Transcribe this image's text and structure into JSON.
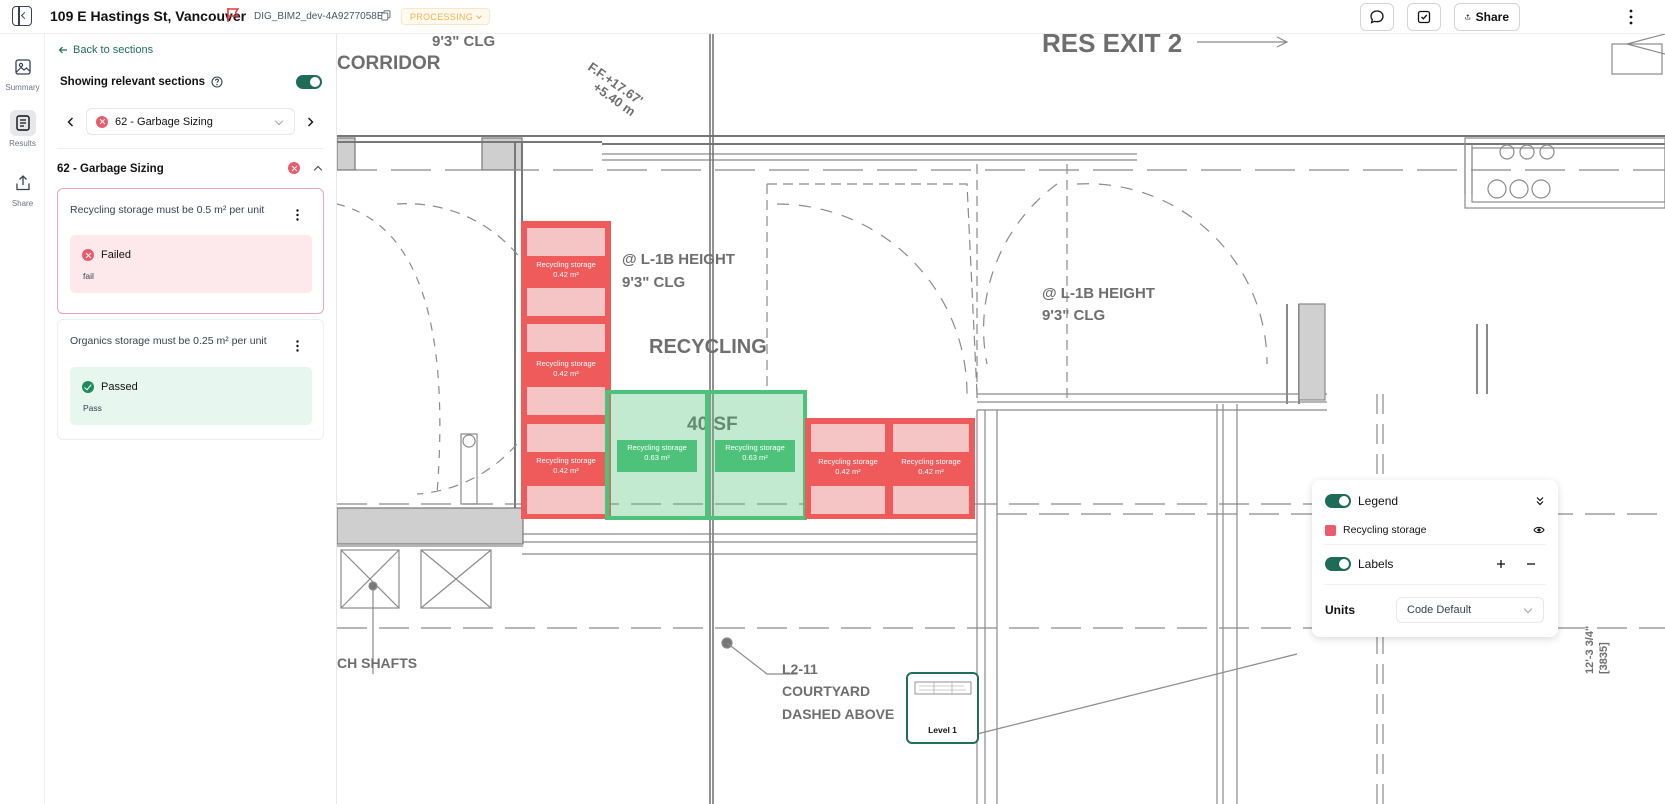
{
  "header": {
    "title": "109 E Hastings St, Vancouver",
    "model_id": "DIG_BIM2_dev-4A9277058E",
    "status": "PROCESSING",
    "share_label": "Share"
  },
  "rail": [
    {
      "label": "Summary",
      "icon": "image-icon"
    },
    {
      "label": "Results",
      "icon": "document-icon"
    },
    {
      "label": "Share",
      "icon": "upload-icon"
    }
  ],
  "panel": {
    "back_label": "Back to sections",
    "showing_label": "Showing relevant sections",
    "selected_section": "62 - Garbage Sizing",
    "section_heading": "62 - Garbage Sizing",
    "rules": [
      {
        "text": "Recycling storage must be 0.5 m² per unit",
        "status": "Failed",
        "detail": "fail"
      },
      {
        "text": "Organics storage must be 0.25 m² per unit",
        "status": "Passed",
        "detail": "Pass"
      }
    ]
  },
  "canvas": {
    "plan_texts": {
      "clg1": "9'3\" CLG",
      "corridor": "CORRIDOR",
      "ff": "F.F.+17.67'",
      "ff2": "+5.40 m",
      "res_exit": "RES EXIT 2",
      "height1": "@ L-1B HEIGHT",
      "clg2": "9'3\" CLG",
      "recycling": "RECYCLING",
      "height2": "@ L-1B HEIGHT",
      "clg3": "9'3\" CLG",
      "sf": "40 SF",
      "shafts": "CH SHAFTS",
      "l2": "L2-11",
      "courtyard": "COURTYARD",
      "dashed": "DASHED ABOVE",
      "dim1": "12'-3 3/4\"",
      "dim2": "[3835]"
    },
    "red_label": "Recycling storage",
    "red_area": "0.42 m²",
    "green_label": "Recycling storage",
    "green_area": "0.63 m²"
  },
  "legend": {
    "title": "Legend",
    "item": "Recycling storage",
    "labels_title": "Labels",
    "units_label": "Units",
    "units_value": "Code Default"
  },
  "minimap": {
    "label": "Level 1"
  },
  "colors": {
    "accent": "#1e6b58",
    "fail": "#ef5a5a",
    "pass": "#4ec27b"
  }
}
